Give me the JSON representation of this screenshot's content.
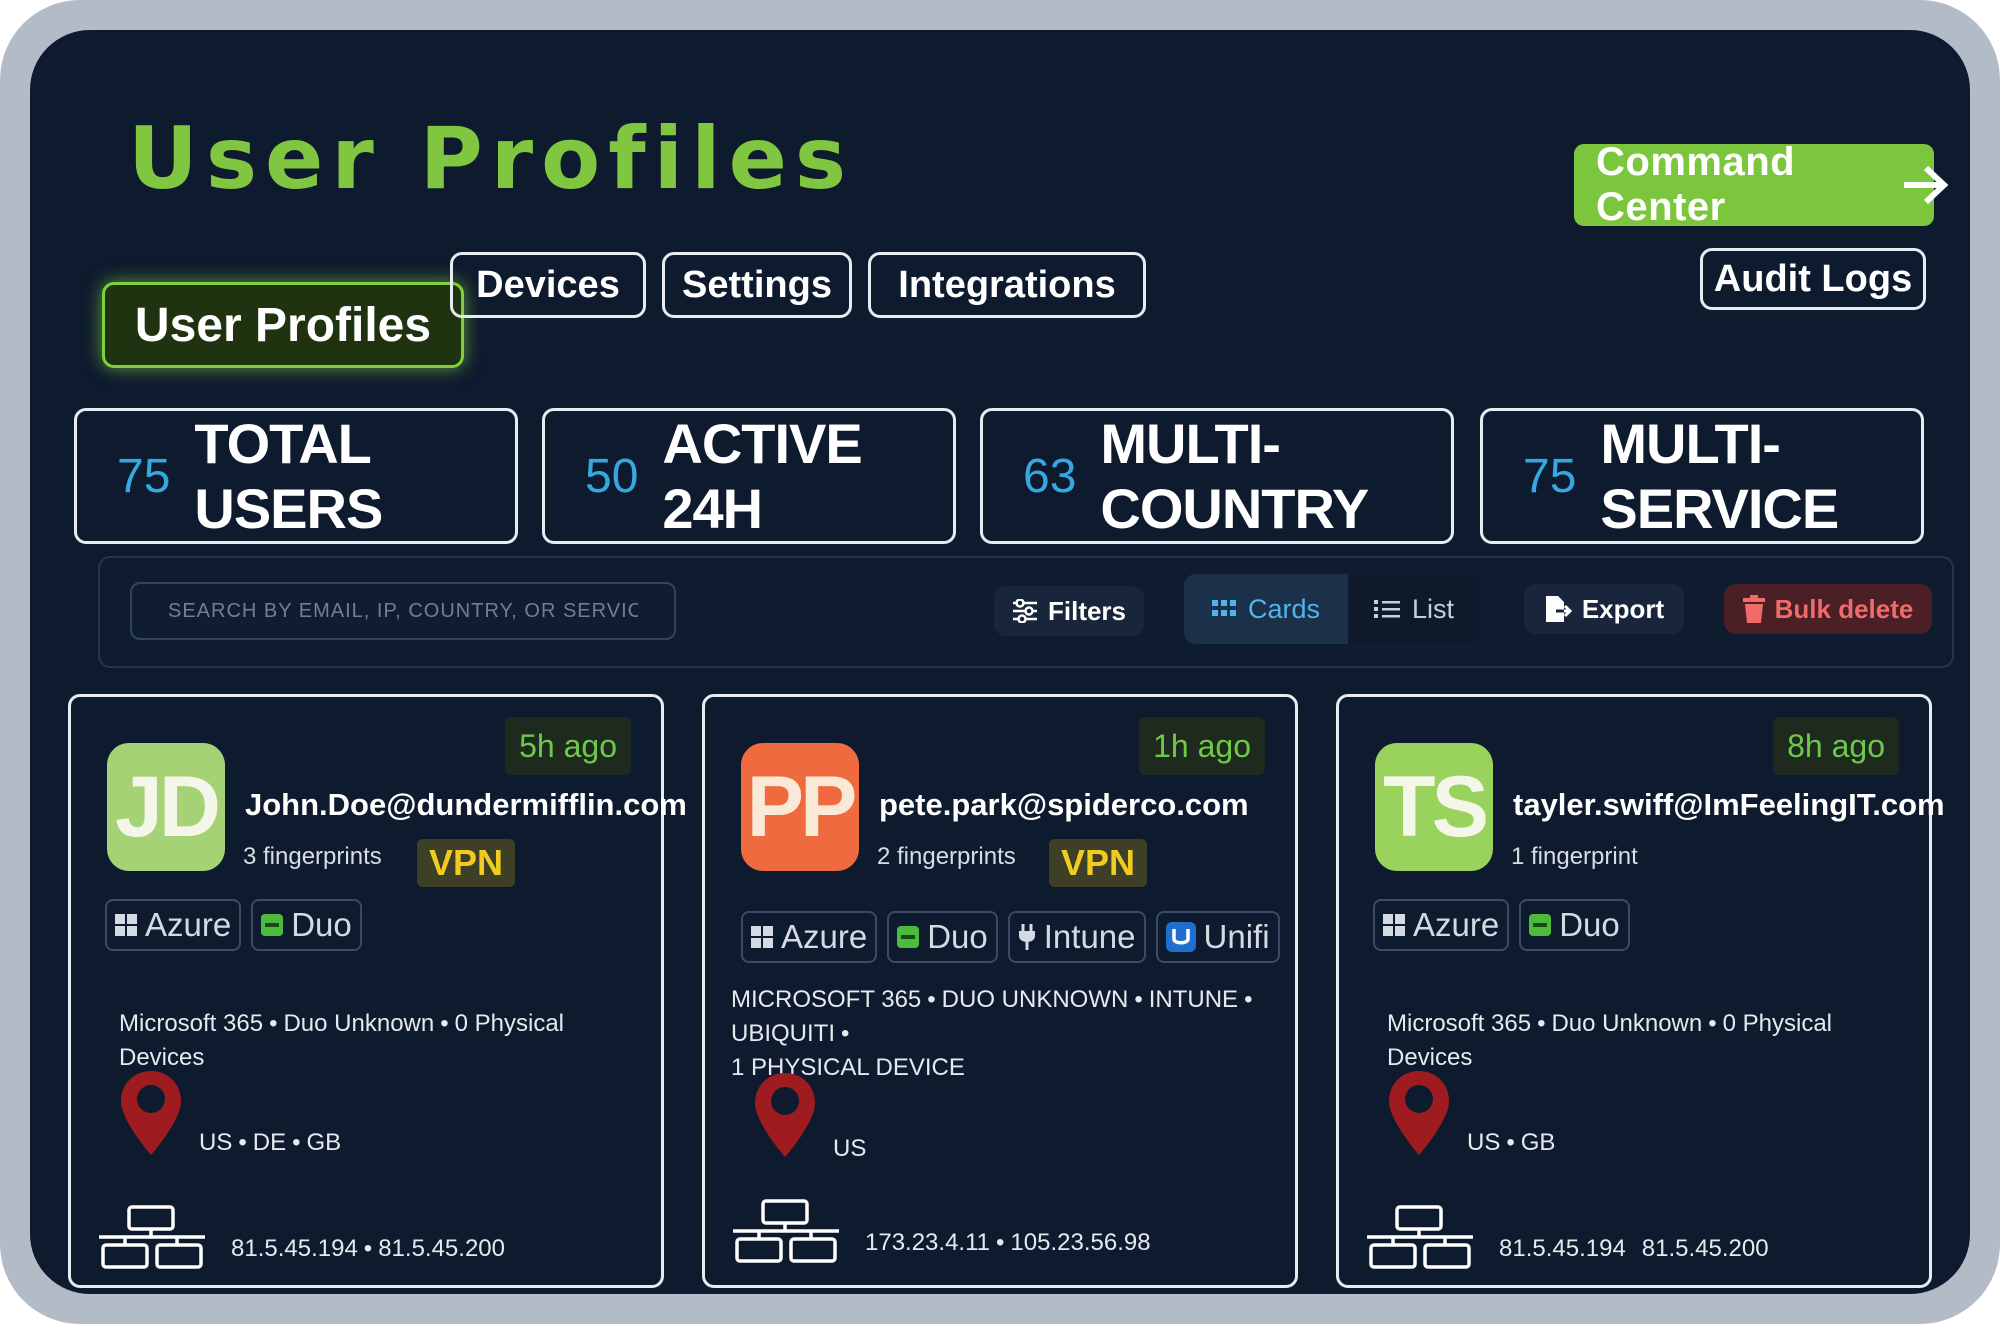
{
  "page_title": "User Profiles",
  "command_center_label": "Command Center",
  "tabs": [
    {
      "label": "User Profiles"
    },
    {
      "label": "Devices"
    },
    {
      "label": "Settings"
    },
    {
      "label": "Integrations"
    }
  ],
  "audit_logs_label": "Audit Logs",
  "stats": [
    {
      "value": "75",
      "label": "TOTAL USERS"
    },
    {
      "value": "50",
      "label": "ACTIVE 24H"
    },
    {
      "value": "63",
      "label": "MULTI-COUNTRY"
    },
    {
      "value": "75",
      "label": "MULTI-SERVICE"
    }
  ],
  "toolbar": {
    "search_placeholder": "SEARCH BY EMAIL, IP, COUNTRY, OR SERVICE...",
    "filters_label": "Filters",
    "view_cards_label": "Cards",
    "view_list_label": "List",
    "selected_view": "Cards",
    "export_label": "Export",
    "bulk_delete_label": "Bulk delete"
  },
  "cards": [
    {
      "time": "5h ago",
      "initials": "JD",
      "avatar_color": "#a6d276",
      "email": "John.Doe@dundermifflin.com",
      "fingerprints": "3 fingerprints",
      "vpn": "VPN",
      "services": [
        "Azure",
        "Duo"
      ],
      "summary": [
        "Microsoft 365",
        "Duo Unknown",
        "0 Physical Devices"
      ],
      "countries": [
        "US",
        "DE",
        "GB"
      ],
      "ips": [
        "81.5.45.194",
        "81.5.45.200"
      ]
    },
    {
      "time": "1h ago",
      "initials": "PP",
      "avatar_color": "#ef6b3f",
      "email": "pete.park@spiderco.com",
      "fingerprints": "2 fingerprints",
      "vpn": "VPN",
      "services": [
        "Azure",
        "Duo",
        "Intune",
        "Unifi"
      ],
      "summary": [
        "MICROSOFT 365",
        "DUO UNKNOWN",
        "INTUNE",
        "UBIQUITI",
        "1 PHYSICAL DEVICE"
      ],
      "countries": [
        "US"
      ],
      "ips": [
        "173.23.4.11",
        "105.23.56.98"
      ]
    },
    {
      "time": "8h ago",
      "initials": "TS",
      "avatar_color": "#9ad25e",
      "email": "tayler.swiff@ImFeelingIT.com",
      "fingerprints": "1 fingerprint",
      "services": [
        "Azure",
        "Duo"
      ],
      "summary": [
        "Microsoft 365",
        "Duo Unknown",
        "0 Physical Devices"
      ],
      "countries": [
        "US",
        "GB"
      ],
      "ips": [
        "81.5.45.194",
        "81.5.45.200"
      ]
    }
  ],
  "colors": {
    "accent_green": "#80c640",
    "stat_blue": "#36a8e0",
    "vpn_yellow": "#f1cc1f",
    "delete_red": "#f06a6a",
    "pin_red": "#9e1c1f"
  }
}
